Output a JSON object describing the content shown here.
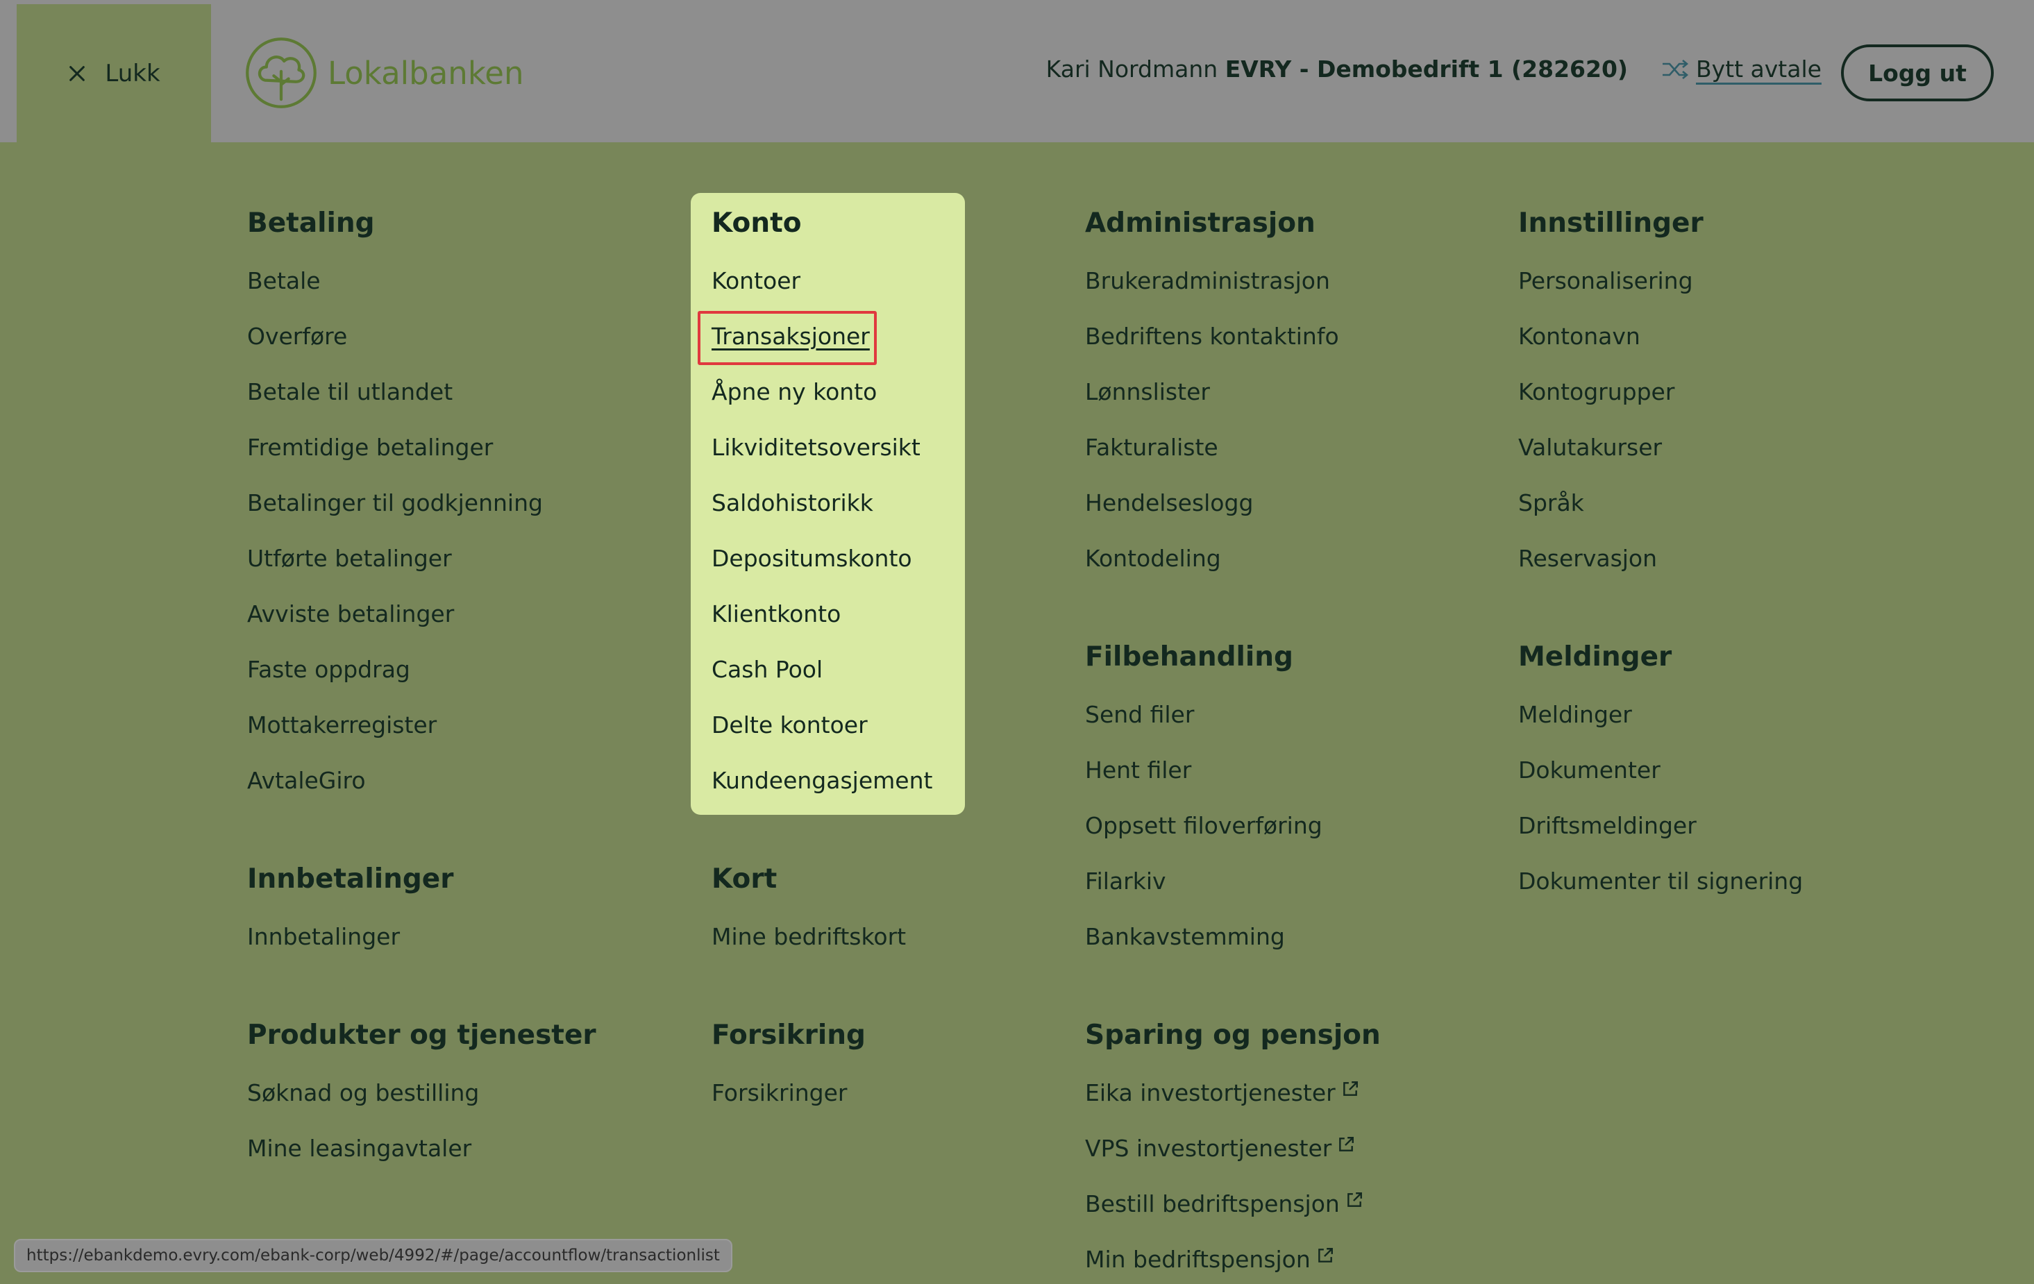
{
  "header": {
    "close_label": "Lukk",
    "logo_text": "Lokalbanken",
    "user_name": "Kari Nordmann",
    "company": "EVRY - Demobedrift 1 (282620)",
    "switch_label": "Bytt avtale",
    "logout_label": "Logg ut"
  },
  "menu": {
    "betaling": {
      "title": "Betaling",
      "items": [
        "Betale",
        "Overføre",
        "Betale til utlandet",
        "Fremtidige betalinger",
        "Betalinger til godkjenning",
        "Utførte betalinger",
        "Avviste betalinger",
        "Faste oppdrag",
        "Mottakerregister",
        "AvtaleGiro"
      ]
    },
    "konto": {
      "title": "Konto",
      "items": [
        "Kontoer",
        "Transaksjoner",
        "Åpne ny konto",
        "Likviditetsoversikt",
        "Saldohistorikk",
        "Depositumskonto",
        "Klientkonto",
        "Cash Pool",
        "Delte kontoer",
        "Kundeengasjement"
      ],
      "selected": "Transaksjoner"
    },
    "administrasjon": {
      "title": "Administrasjon",
      "items": [
        "Brukeradministrasjon",
        "Bedriftens kontaktinfo",
        "Lønnslister",
        "Fakturaliste",
        "Hendelseslogg",
        "Kontodeling"
      ]
    },
    "innstillinger": {
      "title": "Innstillinger",
      "items": [
        "Personalisering",
        "Kontonavn",
        "Kontogrupper",
        "Valutakurser",
        "Språk",
        "Reservasjon"
      ]
    },
    "filbehandling": {
      "title": "Filbehandling",
      "items": [
        "Send filer",
        "Hent filer",
        "Oppsett filoverføring",
        "Filarkiv",
        "Bankavstemming"
      ]
    },
    "meldinger": {
      "title": "Meldinger",
      "items": [
        "Meldinger",
        "Dokumenter",
        "Driftsmeldinger",
        "Dokumenter til signering"
      ]
    },
    "innbetalinger": {
      "title": "Innbetalinger",
      "items": [
        "Innbetalinger"
      ]
    },
    "kort": {
      "title": "Kort",
      "items": [
        "Mine bedriftskort"
      ]
    },
    "produkter": {
      "title": "Produkter og tjenester",
      "items": [
        "Søknad og bestilling",
        "Mine leasingavtaler"
      ]
    },
    "forsikring": {
      "title": "Forsikring",
      "items": [
        "Forsikringer"
      ]
    },
    "sparing": {
      "title": "Sparing og pensjon",
      "items": [
        "Eika investortjenester",
        "VPS investortjenester",
        "Bestill bedriftspensjon",
        "Min bedriftspensjon"
      ]
    }
  },
  "status_url": "https://ebankdemo.evry.com/ebank-corp/web/4992/#/page/accountflow/transactionlist",
  "colors": {
    "overlay_green": "#788659",
    "header_gray": "#8e8e8e",
    "highlight": "#d9eaa3",
    "selection_border": "#e0393f",
    "text": "#13281f",
    "logo_green": "#5d7a34"
  }
}
